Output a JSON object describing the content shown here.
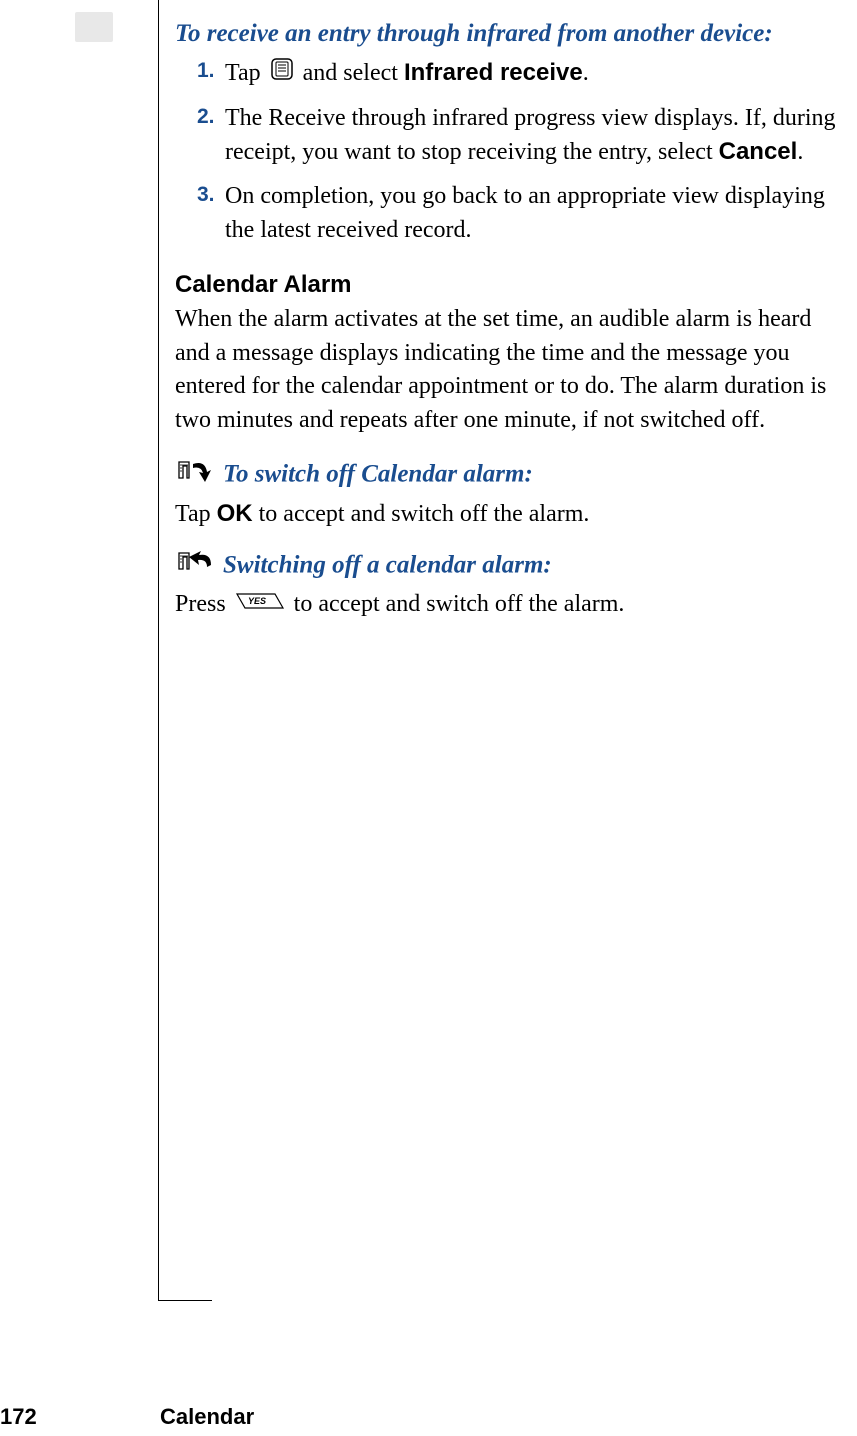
{
  "intro_heading": "To receive an entry through infrared from another device:",
  "steps": [
    {
      "num": "1.",
      "prefix": "Tap ",
      "after_icon": " and select ",
      "bold": "Infrared receive",
      "suffix": "."
    },
    {
      "num": "2.",
      "text_parts": {
        "t1": "The Receive through infrared progress view displays. If, during receipt, you want to stop receiving the entry, select ",
        "bold": "Cancel",
        "t2": "."
      }
    },
    {
      "num": "3.",
      "text": "On completion, you go back to an appropriate view displaying the latest received record."
    }
  ],
  "section_heading": "Calendar Alarm",
  "section_body": "When the alarm activates at the set time, an audible alarm is heard and a message displays indicating the time and the message you entered for the calendar appointment or to do. The alarm duration is two minutes and repeats after one minute, if not switched off.",
  "proc1": {
    "heading": "To switch off Calendar alarm:",
    "t1": "Tap ",
    "bold": "OK",
    "t2": " to accept and switch off the alarm."
  },
  "proc2": {
    "heading": "Switching off a calendar alarm:",
    "t1": "Press ",
    "t2": " to accept and switch off the alarm."
  },
  "footer": {
    "page": "172",
    "title": "Calendar"
  }
}
